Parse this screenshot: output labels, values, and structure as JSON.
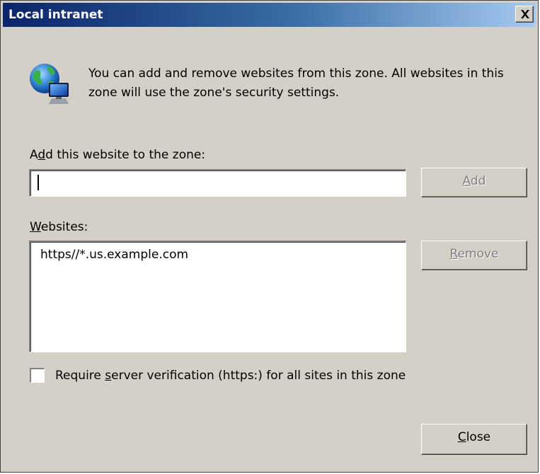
{
  "window": {
    "title": "Local intranet"
  },
  "info": {
    "message": "You can add and remove websites from this zone. All websites in this zone will use the zone's security settings."
  },
  "add_section": {
    "label_pre": "A",
    "label_accel": "d",
    "label_post": "d this website to the zone:",
    "input_value": "",
    "button": {
      "accel": "A",
      "rest": "dd",
      "enabled": false
    }
  },
  "websites_section": {
    "label_accel": "W",
    "label_post": "ebsites:",
    "items": [
      "https//*.us.example.com"
    ],
    "remove_button": {
      "accel": "R",
      "rest": "emove",
      "enabled": false
    }
  },
  "verification": {
    "checked": false,
    "label_pre": "Require ",
    "label_accel": "s",
    "label_post": "erver verification (https:) for all sites in this zone"
  },
  "footer": {
    "close_button": {
      "accel": "C",
      "rest": "lose"
    }
  },
  "icons": {
    "title_close": "close-icon",
    "zone": "globe-computer-icon"
  },
  "colors": {
    "dialog_bg": "#d4d0c8",
    "titlebar_start": "#0a246a",
    "titlebar_end": "#a6caf0",
    "disabled_text": "#808080"
  }
}
